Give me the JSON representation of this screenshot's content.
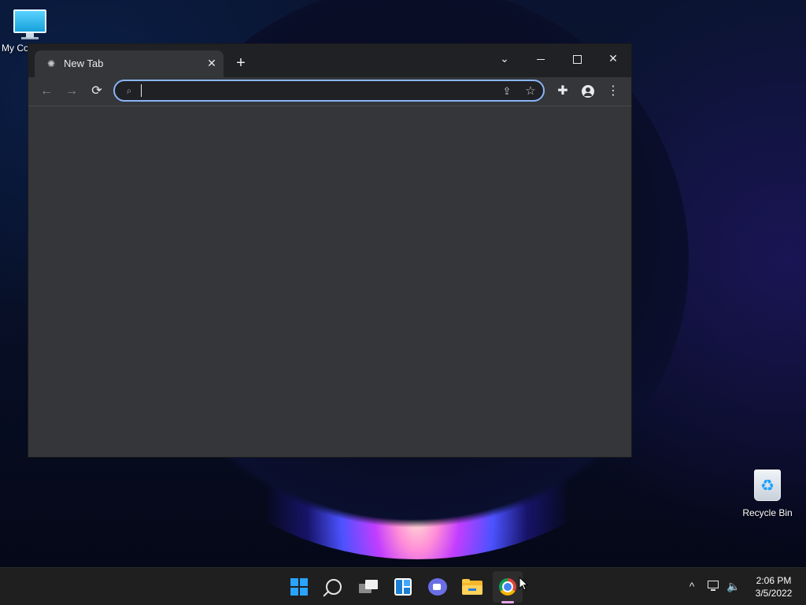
{
  "desktop": {
    "icons": [
      {
        "label": "My Co",
        "icon": "computer-icon"
      },
      {
        "label": "Recycle Bin",
        "icon": "recycle-bin-icon"
      }
    ]
  },
  "browser": {
    "tab": {
      "title": "New Tab",
      "favicon": "chrome-favicon-icon"
    },
    "toolbar": {
      "back": "←",
      "forward": "→",
      "reload": "⟳",
      "omnibox_value": "",
      "omnibox_placeholder": ""
    },
    "window_controls": {
      "tab_search": "⌄",
      "close": "✕"
    },
    "new_tab": "+",
    "menu": "⋮"
  },
  "taskbar": {
    "apps": [
      {
        "name": "start",
        "icon": "windows-start-icon"
      },
      {
        "name": "search",
        "icon": "search-icon"
      },
      {
        "name": "task-view",
        "icon": "task-view-icon"
      },
      {
        "name": "widgets",
        "icon": "widgets-icon"
      },
      {
        "name": "chat",
        "icon": "teams-chat-icon"
      },
      {
        "name": "file-explorer",
        "icon": "folder-icon"
      },
      {
        "name": "chrome",
        "icon": "chrome-icon",
        "active": true
      }
    ],
    "tray": {
      "time": "2:06 PM",
      "date": "3/5/2022"
    }
  },
  "colors": {
    "accent_blue": "#8ab4f8",
    "window_bg": "#35363a",
    "titlebar_bg": "#202124",
    "taskbar_bg": "#1f1f1f",
    "start_blue": "#2aa3ff"
  }
}
